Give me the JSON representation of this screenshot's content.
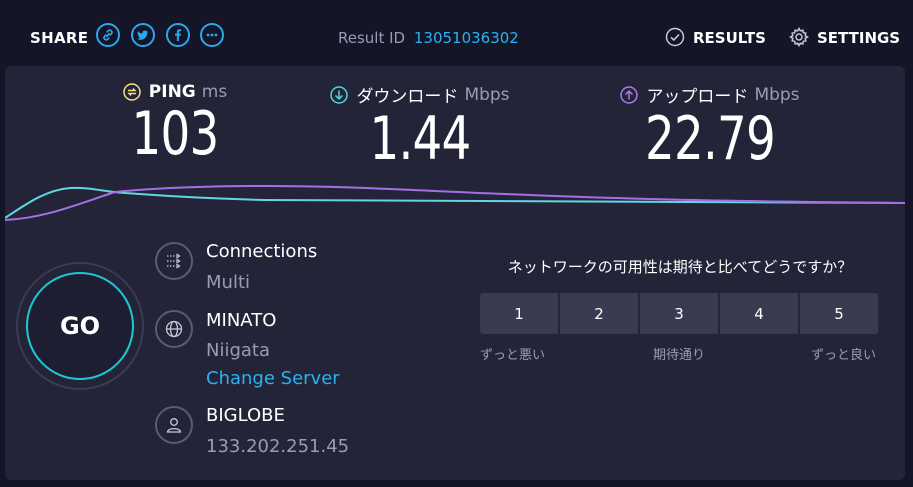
{
  "header": {
    "share_label": "SHARE",
    "share_icons": [
      "link-icon",
      "twitter-icon",
      "facebook-icon",
      "more-icon"
    ],
    "result_label": "Result ID",
    "result_id": "13051036302",
    "results_label": "RESULTS",
    "settings_label": "SETTINGS"
  },
  "metrics": {
    "ping": {
      "name": "PING",
      "unit": "ms",
      "value": "103",
      "color": "#f1e37a"
    },
    "download": {
      "name": "ダウンロード",
      "unit": "Mbps",
      "value": "1.44",
      "color": "#4ad9d9"
    },
    "upload": {
      "name": "アップロード",
      "unit": "Mbps",
      "value": "22.79",
      "color": "#b07ae6"
    }
  },
  "graph": {
    "download_color": "#5fd6e0",
    "upload_color": "#a66ee6"
  },
  "go_label": "GO",
  "connections": {
    "title": "Connections",
    "value": "Multi"
  },
  "server": {
    "name": "MINATO",
    "location": "Niigata",
    "change_label": "Change Server"
  },
  "isp": {
    "name": "BIGLOBE",
    "ip": "133.202.251.45"
  },
  "survey": {
    "question": "ネットワークの可用性は期待と比べてどうですか？",
    "options": [
      "1",
      "2",
      "3",
      "4",
      "5"
    ],
    "low_label": "ずっと悪い",
    "mid_label": "期待通り",
    "high_label": "ずっと良い"
  },
  "colors": {
    "background": "#141526",
    "panel": "#232438",
    "accent_blue": "#2ab2f0",
    "go_ring": "#1fc8d6"
  }
}
